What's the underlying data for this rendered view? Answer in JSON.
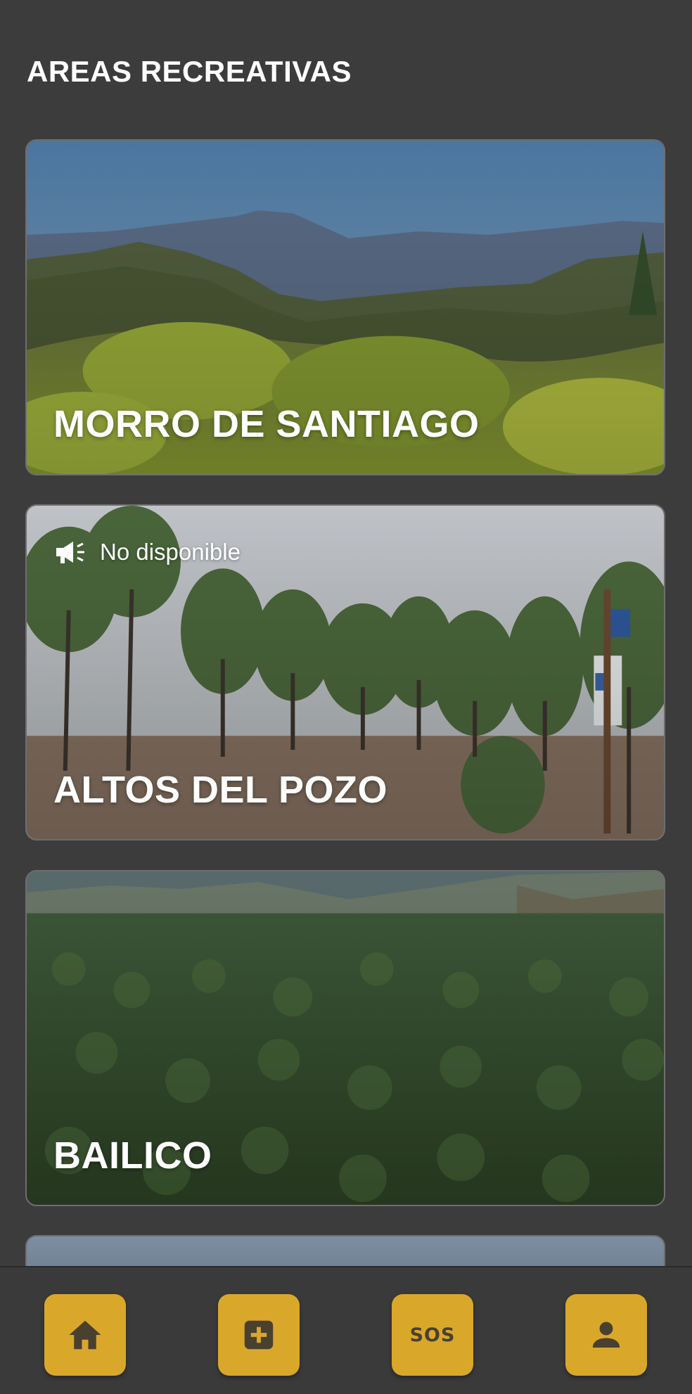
{
  "header": {
    "title": "AREAS RECREATIVAS"
  },
  "areas": [
    {
      "name": "MORRO DE SANTIAGO"
    },
    {
      "name": "ALTOS DEL POZO",
      "audio_status": "No disponible"
    },
    {
      "name": "BAILICO"
    }
  ],
  "bottom_nav": {
    "items": [
      {
        "icon": "home-icon"
      },
      {
        "icon": "plus-box-icon"
      },
      {
        "icon": "sos-icon",
        "label": "SOS"
      },
      {
        "icon": "user-icon"
      }
    ]
  },
  "colors": {
    "background": "#3c3c3d",
    "accent": "#d9a82b",
    "text": "#ffffff"
  }
}
